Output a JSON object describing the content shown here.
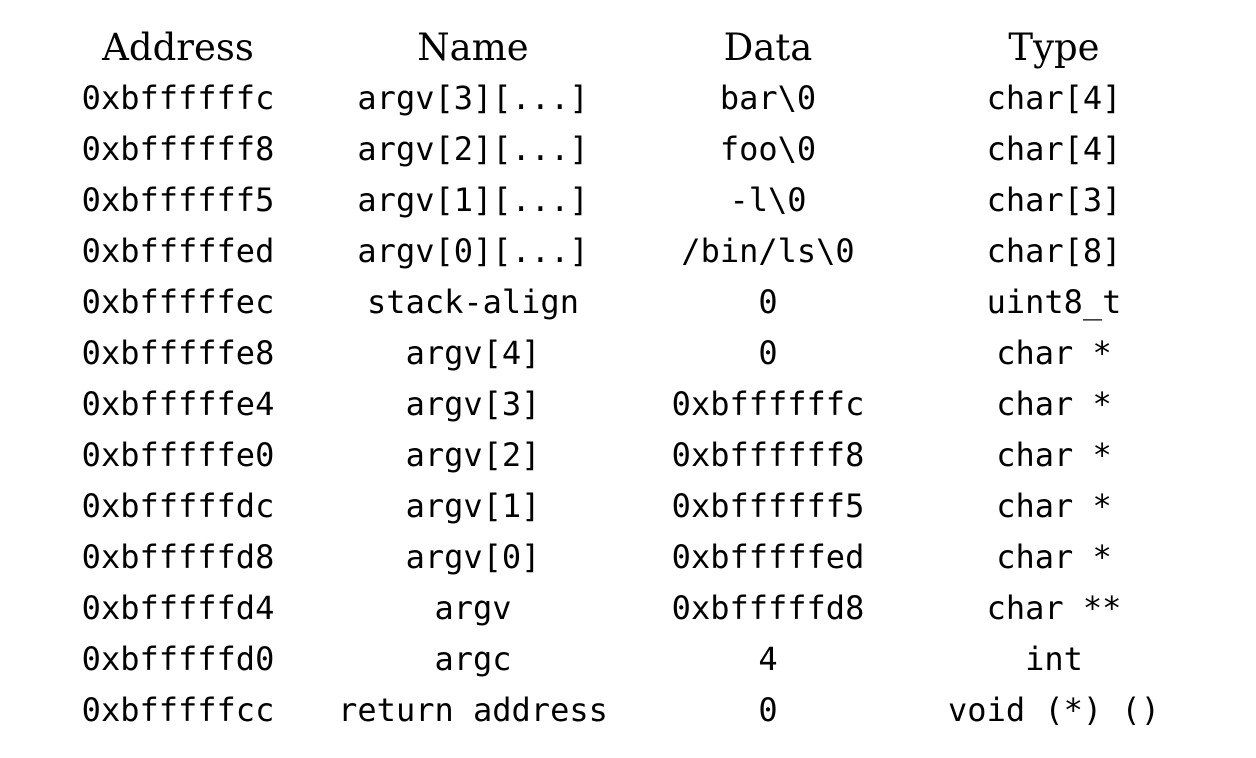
{
  "table": {
    "headers": {
      "address": "Address",
      "name": "Name",
      "data": "Data",
      "type": "Type"
    },
    "rows": [
      {
        "address": "0xbffffffc",
        "name": "argv[3][...]",
        "data": "bar\\0",
        "type": "char[4]"
      },
      {
        "address": "0xbffffff8",
        "name": "argv[2][...]",
        "data": "foo\\0",
        "type": "char[4]"
      },
      {
        "address": "0xbffffff5",
        "name": "argv[1][...]",
        "data": "-l\\0",
        "type": "char[3]"
      },
      {
        "address": "0xbfffffed",
        "name": "argv[0][...]",
        "data": "/bin/ls\\0",
        "type": "char[8]"
      },
      {
        "address": "0xbfffffec",
        "name": "stack-align",
        "data": "0",
        "type": "uint8_t"
      },
      {
        "address": "0xbfffffe8",
        "name": "argv[4]",
        "data": "0",
        "type": "char *"
      },
      {
        "address": "0xbfffffe4",
        "name": "argv[3]",
        "data": "0xbffffffc",
        "type": "char *"
      },
      {
        "address": "0xbfffffe0",
        "name": "argv[2]",
        "data": "0xbffffff8",
        "type": "char *"
      },
      {
        "address": "0xbfffffdc",
        "name": "argv[1]",
        "data": "0xbffffff5",
        "type": "char *"
      },
      {
        "address": "0xbfffffd8",
        "name": "argv[0]",
        "data": "0xbfffffed",
        "type": "char *"
      },
      {
        "address": "0xbfffffd4",
        "name": "argv",
        "data": "0xbfffffd8",
        "type": "char **"
      },
      {
        "address": "0xbfffffd0",
        "name": "argc",
        "data": "4",
        "type": "int"
      },
      {
        "address": "0xbfffffcc",
        "name": "return address",
        "data": "0",
        "type": "void (*) ()"
      }
    ]
  }
}
